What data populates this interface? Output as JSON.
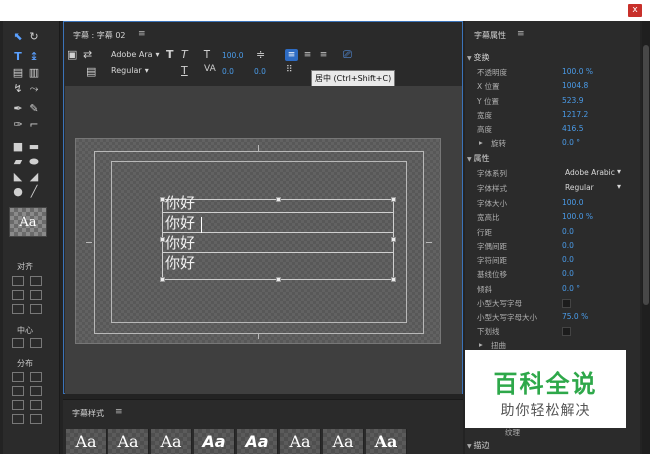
{
  "window": {
    "close_label": "x"
  },
  "tools": {
    "align_label": "对齐",
    "center_label": "中心",
    "distribute_label": "分布",
    "style_swatch": "Aa"
  },
  "title_panel": {
    "tab": "字幕 : 字幕 02",
    "menu_icon": "≡",
    "font_family": "Adobe Ara",
    "font_style": "Regular",
    "font_size_value": "100.0",
    "kerning_value": "0.0",
    "leading_value": "0.0",
    "tooltip": "居中 (Ctrl+Shift+C)",
    "lines": [
      "你好",
      "你好",
      "你好",
      "你好"
    ]
  },
  "styles_panel": {
    "title": "字幕样式",
    "menu_icon": "≡",
    "samples": [
      "Aa",
      "Aa",
      "Aa",
      "Aa",
      "Aa",
      "Aa",
      "Aa",
      "Aa"
    ]
  },
  "properties_panel": {
    "title": "字幕属性",
    "menu_icon": "≡",
    "transform_head": "变换",
    "transform": [
      {
        "label": "不透明度",
        "value": "100.0 %"
      },
      {
        "label": "X 位置",
        "value": "1004.8"
      },
      {
        "label": "Y 位置",
        "value": "523.9"
      },
      {
        "label": "宽度",
        "value": "1217.2"
      },
      {
        "label": "高度",
        "value": "416.5"
      },
      {
        "label": "旋转",
        "value": "0.0 °"
      }
    ],
    "properties_head": "属性",
    "properties": [
      {
        "label": "字体系列",
        "value": "Adobe Arabic"
      },
      {
        "label": "字体样式",
        "value": "Regular"
      },
      {
        "label": "字体大小",
        "value": "100.0"
      },
      {
        "label": "宽高比",
        "value": "100.0 %"
      },
      {
        "label": "行距",
        "value": "0.0"
      },
      {
        "label": "字偶间距",
        "value": "0.0"
      },
      {
        "label": "字符间距",
        "value": "0.0"
      },
      {
        "label": "基线位移",
        "value": "0.0"
      },
      {
        "label": "倾斜",
        "value": "0.0 °"
      },
      {
        "label": "小型大写字母",
        "value": ""
      },
      {
        "label": "小型大写字母大小",
        "value": "75.0 %"
      },
      {
        "label": "下划线",
        "value": ""
      },
      {
        "label": "扭曲",
        "value": ""
      }
    ],
    "texture_label": "纹理",
    "stroke_head": "描边"
  },
  "watermark": {
    "main": "百科全说",
    "sub": "助你轻松解决"
  },
  "colors": {
    "accent": "#2e6cc4",
    "value_blue": "#4a9be8",
    "panel_border": "#3b73b9",
    "watermark_green": "#2ea84a"
  }
}
